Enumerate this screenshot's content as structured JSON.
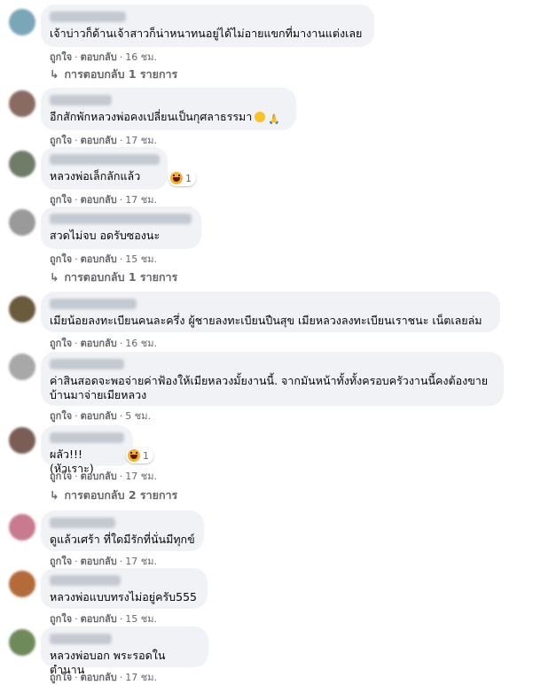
{
  "actions": {
    "like": "ถูกใจ",
    "reply": "ตอบกลับ",
    "separator": "·"
  },
  "colors": {
    "bubble": "#f0f2f5",
    "meta": "#65676b",
    "text": "#050505",
    "haha_reaction": "#f7b125"
  },
  "comments": [
    {
      "text": "เจ้าบ่าวก็ด้านเจ้าสาวก็น่าหนาทนอยู่ได้ไม่อายแขกที่มางานแต่งเลย",
      "time": "16 ชม.",
      "replies": "การตอบกลับ 1 รายการ",
      "avatar_color": "#7aa7b8"
    },
    {
      "text": "อีกสักพักหลวงพ่อคงเปลี่ยนเป็นกุศลาธรรมา",
      "time": "17 ชม.",
      "emoji": [
        "grinning-face-emoji",
        "folded-hands-emoji"
      ],
      "emoji_glyphs": [
        "😁",
        "🙏"
      ],
      "avatar_color": "#8a6b62"
    },
    {
      "text": "หลวงพ่อเล็กลักแล้ว",
      "time": "17 ชม.",
      "reaction_icon": "haha-reaction-icon",
      "reaction_count": "1",
      "avatar_color": "#6f7c68"
    },
    {
      "text": "สวดไม่จบ อดรับซองนะ",
      "time": "15 ชม.",
      "replies": "การตอบกลับ 1 รายการ",
      "avatar_color": "#9a9a9a"
    },
    {
      "text": "เมียน้อยลงทะเบียนคนละครึ่ง ผู้ชายลงทะเบียนปืนสุข เมียหลวงลงทะเบียนเราชนะ เน็ตเลยล่ม",
      "time": "16 ชม.",
      "avatar_color": "#6a5a3e"
    },
    {
      "text": "ค่าสินสอดจะพอจ่ายค่าฟ้องให้เมียหลวงมั้ยงานนี้. จากมันหน้าทั้งทั้งครอบครัวงานนี้คงต้องขายบ้านมาจ่ายเมียหลวง",
      "time": "5 ชม.",
      "avatar_color": "#a8a8a8"
    },
    {
      "text": "ผลัว!!! (หัวเราะ)",
      "time": "17 ชม.",
      "replies": "การตอบกลับ 2 รายการ",
      "reaction_icon": "haha-reaction-icon",
      "reaction_count": "1",
      "avatar_color": "#7a5d55"
    },
    {
      "text": "ดูแล้วเศร้า ที่ใดมีรักที่นั่นมีทุกข์",
      "time": "17 ชม.",
      "avatar_color": "#c97a8e"
    },
    {
      "text": "หลวงพ่อแบบทรงไม่อยู่ครับ555",
      "time": "15 ชม.",
      "avatar_color": "#b56a3a"
    },
    {
      "text": "หลวงพ่อบอก พระรอดในตำนาน",
      "time": "17 ชม.",
      "avatar_color": "#6e8a5a"
    }
  ]
}
